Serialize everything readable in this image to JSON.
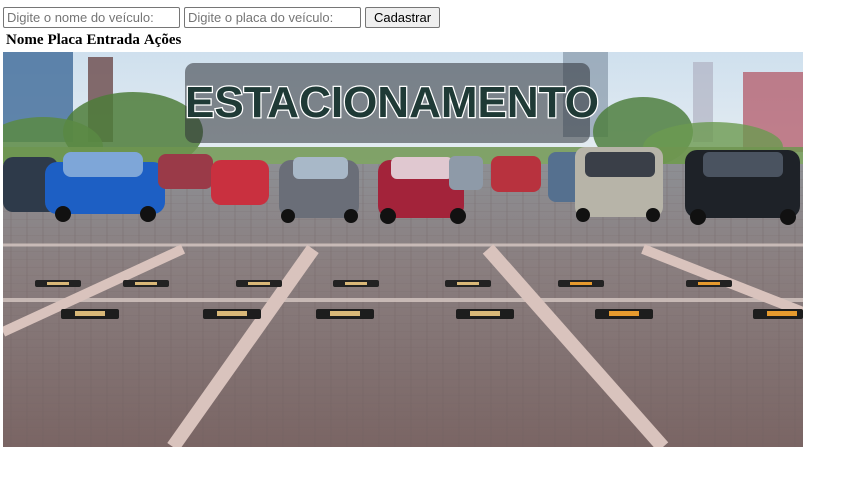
{
  "form": {
    "nome_placeholder": "Digite o nome do veículo:",
    "placa_placeholder": "Digite o placa do veículo:",
    "submit_label": "Cadastrar"
  },
  "table": {
    "headers": [
      "Nome",
      "Placa",
      "Entrada",
      "Ações"
    ]
  },
  "banner": {
    "title": "ESTACIONAMENTO"
  },
  "colors": {
    "title_fill": "#1f3a36",
    "title_stroke": "#ffffff",
    "title_box": "rgba(45,50,55,0.55)"
  }
}
